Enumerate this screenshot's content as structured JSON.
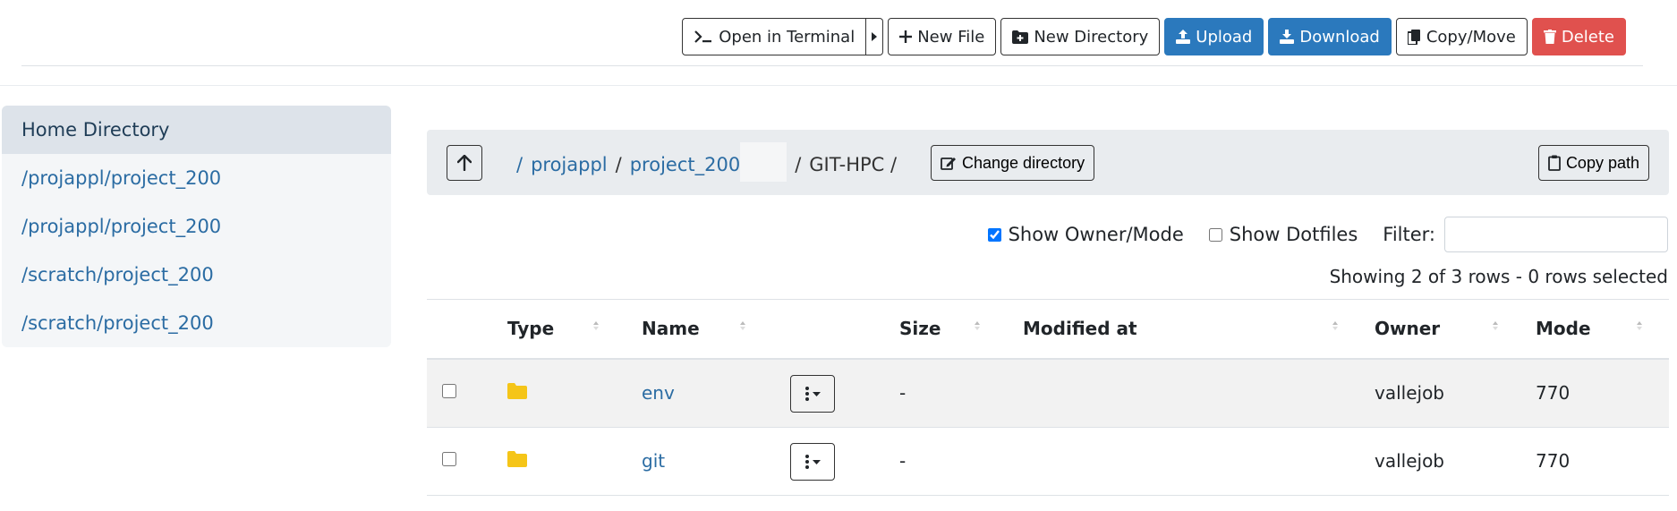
{
  "toolbar": {
    "open_terminal": "Open in Terminal",
    "new_file": "New File",
    "new_directory": "New Directory",
    "upload": "Upload",
    "download": "Download",
    "copy_move": "Copy/Move",
    "delete": "Delete"
  },
  "sidebar": {
    "items": [
      {
        "label": "Home Directory"
      },
      {
        "label": "/projappl/project_200"
      },
      {
        "label": "/projappl/project_200"
      },
      {
        "label": "/scratch/project_200"
      },
      {
        "label": "/scratch/project_200"
      }
    ]
  },
  "breadcrumb": {
    "root_sep": "/",
    "seg1": "projappl",
    "sep": "/",
    "seg2": "project_200",
    "current": "GIT-HPC /",
    "change_directory": "Change directory",
    "copy_path": "Copy path"
  },
  "options": {
    "show_owner_mode": "Show Owner/Mode",
    "show_owner_mode_checked": true,
    "show_dotfiles": "Show Dotfiles",
    "show_dotfiles_checked": false,
    "filter_label": "Filter:",
    "filter_value": ""
  },
  "row_count": "Showing 2 of 3 rows - 0 rows selected",
  "table": {
    "headers": {
      "type": "Type",
      "name": "Name",
      "size": "Size",
      "modified": "Modified at",
      "owner": "Owner",
      "mode": "Mode"
    },
    "rows": [
      {
        "name": "env",
        "size": "-",
        "modified": "",
        "owner": "vallejob",
        "mode": "770"
      },
      {
        "name": "git",
        "size": "-",
        "modified": "",
        "owner": "vallejob",
        "mode": "770"
      }
    ]
  },
  "colors": {
    "primary": "#2b79bd",
    "danger": "#e0514e",
    "link": "#2b6ca3",
    "folder": "#f5c518"
  }
}
